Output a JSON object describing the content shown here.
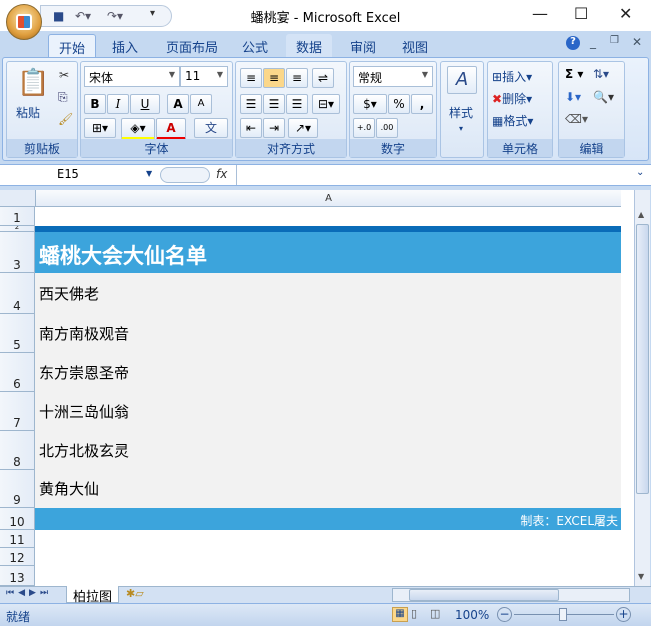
{
  "window": {
    "title": "蟠桃宴 - Microsoft Excel",
    "minimize": "—",
    "maximize": "☐",
    "close": "✕"
  },
  "ribbon_tabs": [
    {
      "label": "开始"
    },
    {
      "label": "插入"
    },
    {
      "label": "页面布局"
    },
    {
      "label": "公式"
    },
    {
      "label": "数据"
    },
    {
      "label": "审阅"
    },
    {
      "label": "视图"
    }
  ],
  "clipboard": {
    "paste": "粘贴",
    "label": "剪贴板"
  },
  "font": {
    "name": "宋体",
    "size": "11",
    "bold": "B",
    "italic": "I",
    "underline": "U",
    "grow": "A",
    "shrink": "A",
    "color": "A",
    "phonetic": "文",
    "label": "字体",
    "fill_color": "#ffff00",
    "font_color": "#ff0000"
  },
  "alignment": {
    "label": "对齐方式"
  },
  "number": {
    "format": "常规",
    "percent": "%",
    "comma": ",",
    "inc": "+.0",
    "dec": ".00",
    "label": "数字"
  },
  "styles": {
    "label": "样式"
  },
  "cells": {
    "insert": "插入",
    "delete": "删除",
    "format": "格式",
    "label": "单元格"
  },
  "editing": {
    "sum": "Σ",
    "label": "编辑"
  },
  "formula_bar": {
    "name_box": "E15",
    "fx": "fx",
    "value": ""
  },
  "sheet": {
    "column": "A",
    "rows": [
      "1",
      "2",
      "3",
      "4",
      "5",
      "6",
      "7",
      "8",
      "9",
      "10",
      "11",
      "12",
      "13"
    ],
    "header": "蟠桃大会大仙名单",
    "names": [
      "西天佛老",
      "南方南极观音",
      "东方崇恩圣帝",
      "十洲三岛仙翁",
      "北方北极玄灵",
      "黄角大仙"
    ],
    "footer": "制表：EXCEL屠夫",
    "header_color": "#3ca4dc",
    "top_bar_color": "#0a6cb8"
  },
  "sheet_tabs": [
    {
      "label": "柏拉图"
    }
  ],
  "status": {
    "ready": "就绪",
    "zoom": "100%"
  }
}
